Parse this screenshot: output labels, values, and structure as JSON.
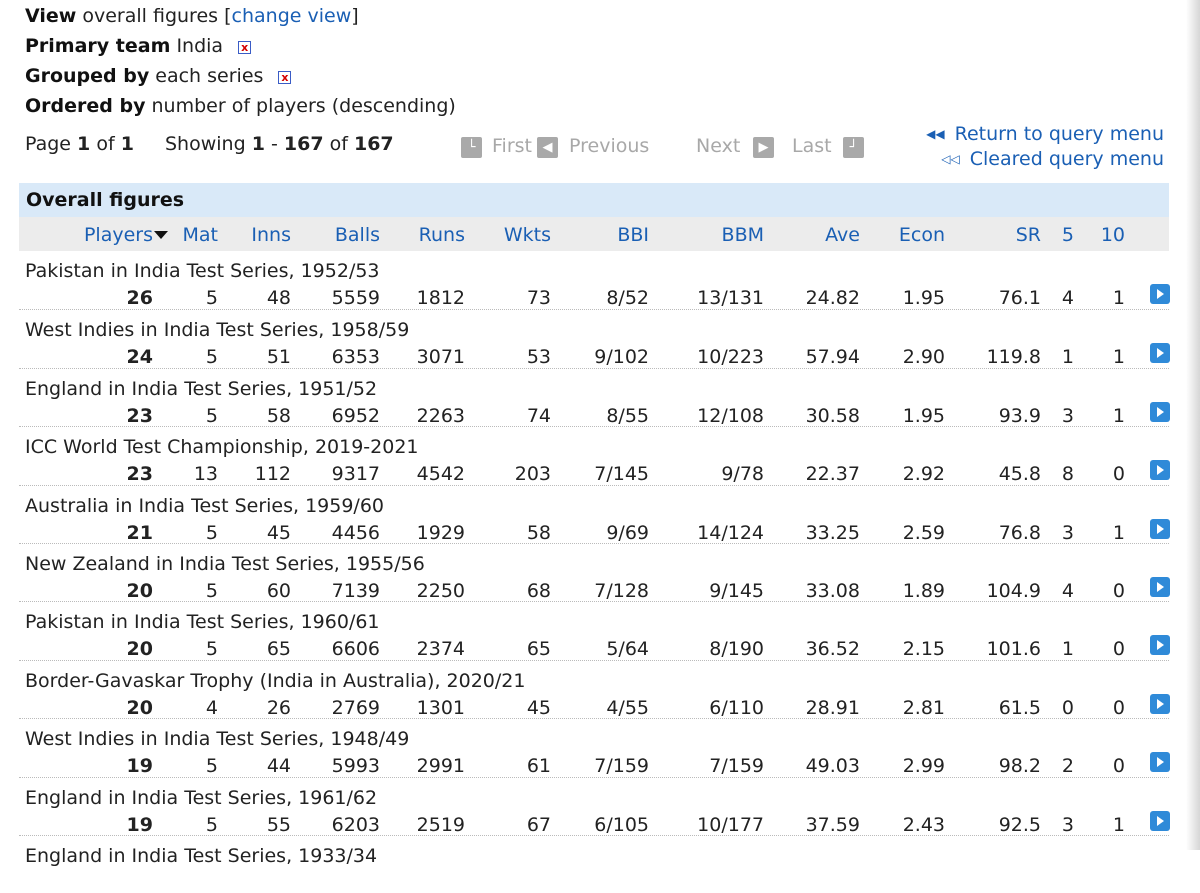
{
  "query": {
    "view_label": "View",
    "view_value": "overall figures",
    "change_view_open": "[",
    "change_view_link": "change view",
    "change_view_close": "]",
    "primary_team_label": "Primary team",
    "primary_team_value": "India",
    "grouped_by_label": "Grouped by",
    "grouped_by_value": "each series",
    "ordered_by_label": "Ordered by",
    "ordered_by_value": "number of players (descending)",
    "remove_glyph": "x"
  },
  "pagination": {
    "page_label": "Page",
    "page_current": "1",
    "page_of": "of",
    "page_total": "1",
    "showing_label": "Showing",
    "showing_from": "1",
    "showing_dash": "-",
    "showing_to": "167",
    "showing_of": "of",
    "showing_total": "167",
    "first_label": "First",
    "previous_label": "Previous",
    "next_label": "Next",
    "last_label": "Last"
  },
  "links": {
    "return_label": "Return to query menu",
    "cleared_label": "Cleared query menu",
    "return_glyph": "◀◀",
    "cleared_glyph": "◁◁"
  },
  "table": {
    "title": "Overall figures",
    "columns": [
      "Players",
      "Mat",
      "Inns",
      "Balls",
      "Runs",
      "Wkts",
      "BBI",
      "BBM",
      "Ave",
      "Econ",
      "SR",
      "5",
      "10"
    ],
    "rows": [
      {
        "series": "Pakistan in India Test Series, 1952/53",
        "values": [
          "26",
          "5",
          "48",
          "5559",
          "1812",
          "73",
          "8/52",
          "13/131",
          "24.82",
          "1.95",
          "76.1",
          "4",
          "1"
        ]
      },
      {
        "series": "West Indies in India Test Series, 1958/59",
        "values": [
          "24",
          "5",
          "51",
          "6353",
          "3071",
          "53",
          "9/102",
          "10/223",
          "57.94",
          "2.90",
          "119.8",
          "1",
          "1"
        ]
      },
      {
        "series": "England in India Test Series, 1951/52",
        "values": [
          "23",
          "5",
          "58",
          "6952",
          "2263",
          "74",
          "8/55",
          "12/108",
          "30.58",
          "1.95",
          "93.9",
          "3",
          "1"
        ]
      },
      {
        "series": "ICC World Test Championship, 2019-2021",
        "values": [
          "23",
          "13",
          "112",
          "9317",
          "4542",
          "203",
          "7/145",
          "9/78",
          "22.37",
          "2.92",
          "45.8",
          "8",
          "0"
        ]
      },
      {
        "series": "Australia in India Test Series, 1959/60",
        "values": [
          "21",
          "5",
          "45",
          "4456",
          "1929",
          "58",
          "9/69",
          "14/124",
          "33.25",
          "2.59",
          "76.8",
          "3",
          "1"
        ]
      },
      {
        "series": "New Zealand in India Test Series, 1955/56",
        "values": [
          "20",
          "5",
          "60",
          "7139",
          "2250",
          "68",
          "7/128",
          "9/145",
          "33.08",
          "1.89",
          "104.9",
          "4",
          "0"
        ]
      },
      {
        "series": "Pakistan in India Test Series, 1960/61",
        "values": [
          "20",
          "5",
          "65",
          "6606",
          "2374",
          "65",
          "5/64",
          "8/190",
          "36.52",
          "2.15",
          "101.6",
          "1",
          "0"
        ]
      },
      {
        "series": "Border-Gavaskar Trophy (India in Australia), 2020/21",
        "values": [
          "20",
          "4",
          "26",
          "2769",
          "1301",
          "45",
          "4/55",
          "6/110",
          "28.91",
          "2.81",
          "61.5",
          "0",
          "0"
        ]
      },
      {
        "series": "West Indies in India Test Series, 1948/49",
        "values": [
          "19",
          "5",
          "44",
          "5993",
          "2991",
          "61",
          "7/159",
          "7/159",
          "49.03",
          "2.99",
          "98.2",
          "2",
          "0"
        ]
      },
      {
        "series": "England in India Test Series, 1961/62",
        "values": [
          "19",
          "5",
          "55",
          "6203",
          "2519",
          "67",
          "6/105",
          "10/177",
          "37.59",
          "2.43",
          "92.5",
          "3",
          "1"
        ]
      },
      {
        "series": "England in India Test Series, 1933/34",
        "values": []
      }
    ]
  }
}
